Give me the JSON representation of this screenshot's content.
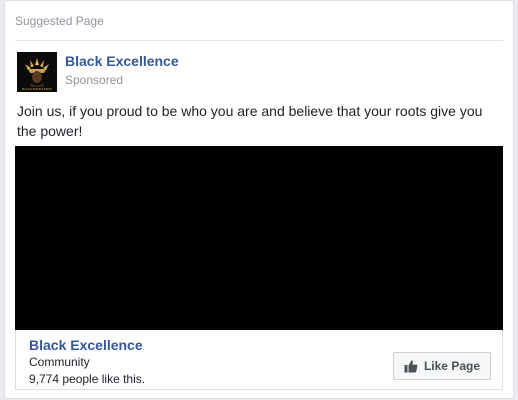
{
  "header": {
    "label": "Suggested Page"
  },
  "post": {
    "page_name": "Black Excellence",
    "sponsored_label": "Sponsored",
    "text": "Join us, if you proud to be who you are and believe that your roots give you the power!",
    "avatar_caption": "BLACK EXCELLENCE"
  },
  "link": {
    "title": "Black Excellence",
    "category": "Community",
    "likes": "9,774 people like this.",
    "like_button_label": "Like Page"
  },
  "colors": {
    "link_blue": "#365899",
    "muted_gray": "#90949c",
    "media_bg": "#000000"
  },
  "icons": {
    "like_button": "thumbs-up-icon"
  }
}
